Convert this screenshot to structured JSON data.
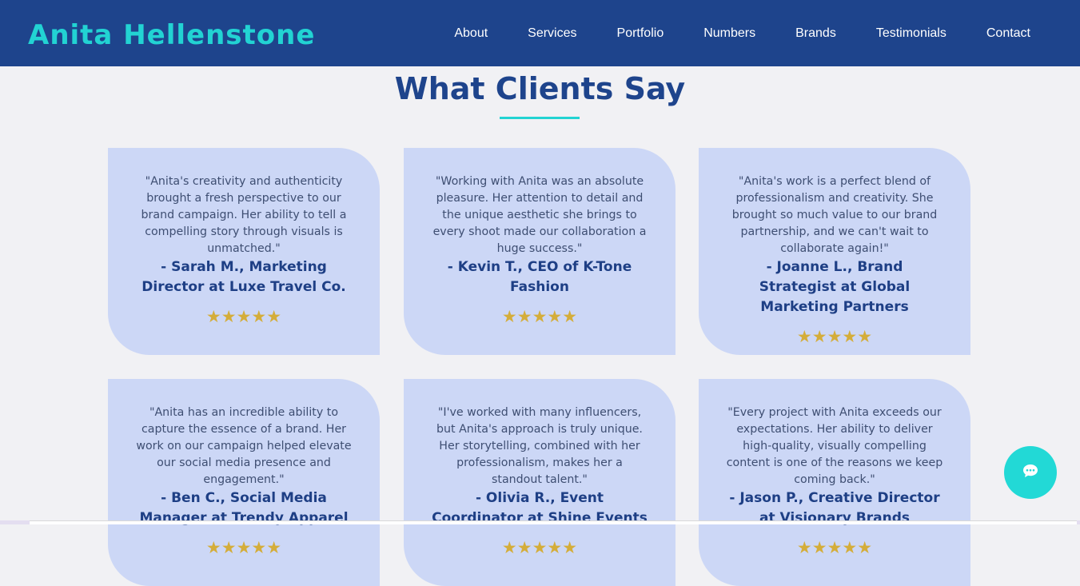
{
  "header": {
    "brand": "Anita Hellenstone",
    "nav": [
      "About",
      "Services",
      "Portfolio",
      "Numbers",
      "Brands",
      "Testimonials",
      "Contact"
    ]
  },
  "testimonials": {
    "title": "What Clients Say",
    "items": [
      {
        "quote": "\"Anita's creativity and authenticity brought a fresh perspective to our brand campaign. Her ability to tell a compelling story through visuals is unmatched.\"",
        "author": "- Sarah M., Marketing Director at Luxe Travel Co.",
        "rating": 5,
        "stars": "★★★★★"
      },
      {
        "quote": "\"Working with Anita was an absolute pleasure. Her attention to detail and the unique aesthetic she brings to every shoot made our collaboration a huge success.\"",
        "author": "- Kevin T., CEO of K-Tone Fashion",
        "rating": 5,
        "stars": "★★★★★"
      },
      {
        "quote": "\"Anita's work is a perfect blend of professionalism and creativity. She brought so much value to our brand partnership, and we can't wait to collaborate again!\"",
        "author": "- Joanne L., Brand Strategist at Global Marketing Partners",
        "rating": 5,
        "stars": "★★★★★"
      },
      {
        "quote": "\"Anita has an incredible ability to capture the essence of a brand. Her work on our campaign helped elevate our social media presence and engagement.\"",
        "author": "- Ben C., Social Media Manager at Trendy Apparel",
        "rating": 5,
        "stars": "★★★★★"
      },
      {
        "quote": "\"I've worked with many influencers, but Anita's approach is truly unique. Her storytelling, combined with her professionalism, makes her a standout talent.\"",
        "author": "- Olivia R., Event Coordinator at Shine Events",
        "rating": 5,
        "stars": "★★★★★"
      },
      {
        "quote": "\"Every project with Anita exceeds our expectations. Her ability to deliver high-quality, visually compelling content is one of the reasons we keep coming back.\"",
        "author": "- Jason P., Creative Director at Visionary Brands",
        "rating": 5,
        "stars": "★★★★★"
      }
    ]
  },
  "chat": {
    "icon": "chat-bubble-icon",
    "color": "#22d9d6"
  },
  "colors": {
    "header_bg": "#1e448c",
    "accent": "#22d3d3",
    "card_bg": "#ccd7f6",
    "star": "#d4ad3a",
    "page_bg": "#f1f1f4"
  }
}
